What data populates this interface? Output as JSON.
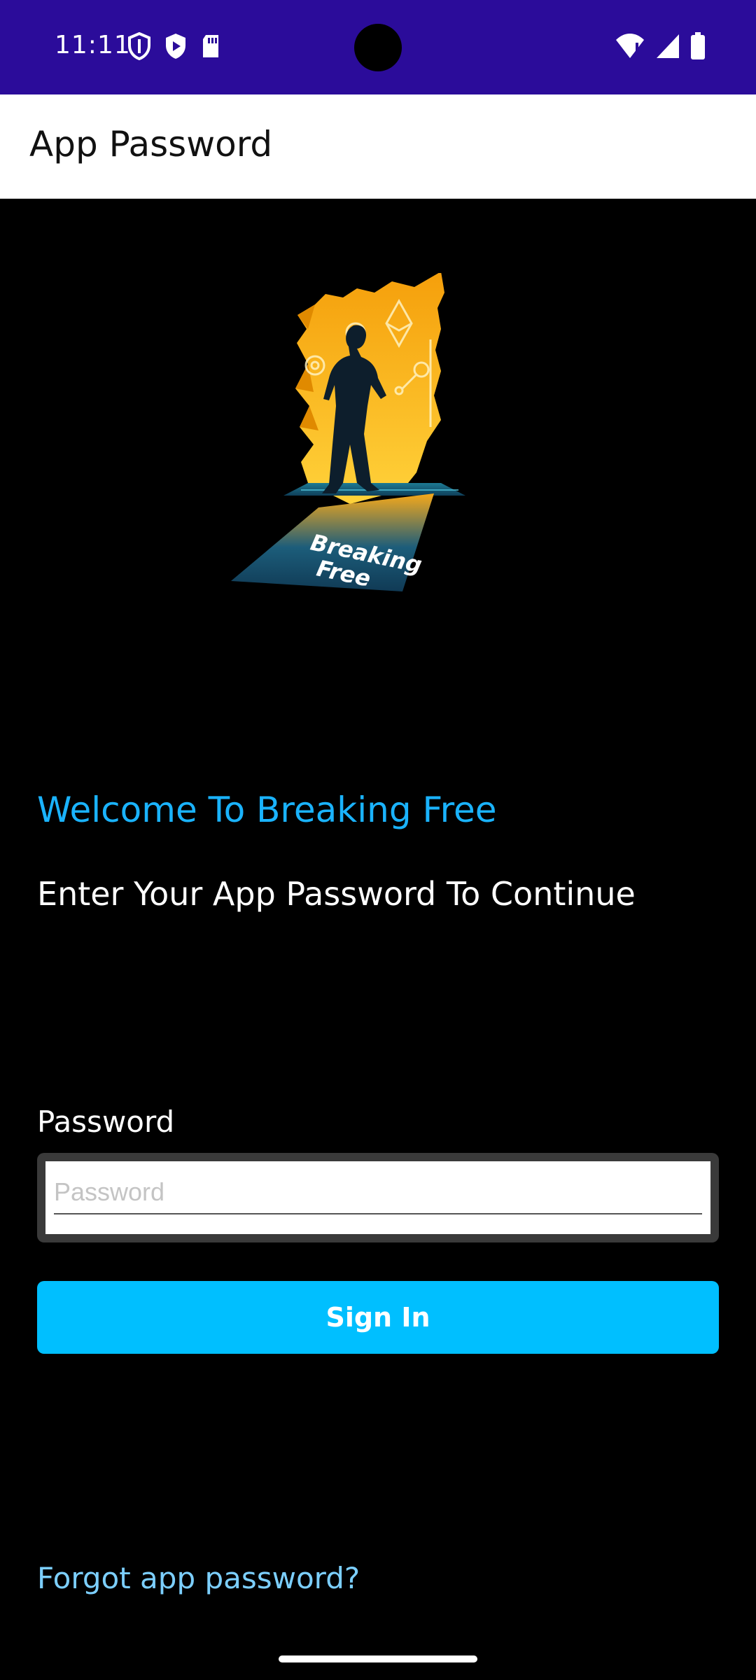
{
  "status_bar": {
    "time": "11:11",
    "background": "#2b0c9a",
    "left_icons": [
      "shield-icon",
      "play-protect-icon",
      "sd-card-icon"
    ],
    "right_icons": [
      "wifi-alert-icon",
      "signal-icon",
      "battery-icon"
    ]
  },
  "app_bar": {
    "title": "App Password"
  },
  "logo": {
    "text": "Breaking Free"
  },
  "welcome": {
    "heading": "Welcome To Breaking Free",
    "subheading": "Enter Your App Password To Continue"
  },
  "password": {
    "label": "Password",
    "placeholder": "Password",
    "value": ""
  },
  "sign_in": {
    "label": "Sign In",
    "color": "#00bfff"
  },
  "forgot": {
    "label": "Forgot app password?"
  }
}
